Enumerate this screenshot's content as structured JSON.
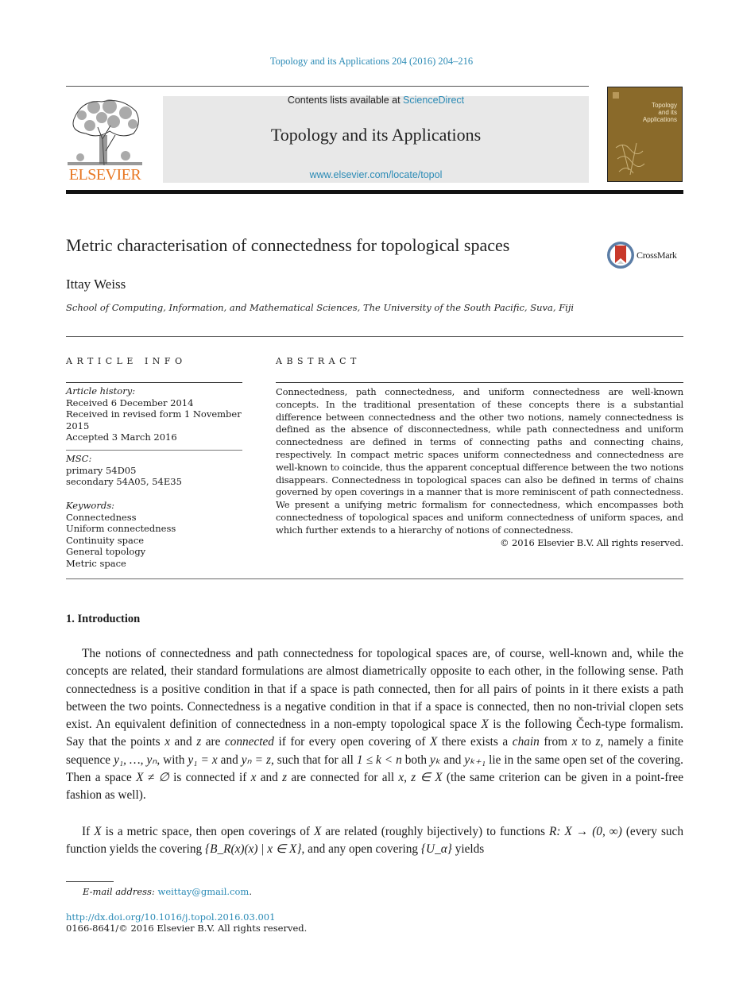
{
  "header": {
    "journal_reference": "Topology and its Applications 204 (2016) 204–216",
    "contents_prefix": "Contents lists available at ",
    "contents_link": "ScienceDirect",
    "journal_title": "Topology and its Applications",
    "journal_url": "www.elsevier.com/locate/topol",
    "publisher_logo_text": "ELSEVIER",
    "cover_title": "Topology\nand its\nApplications",
    "colors": {
      "link": "#2a8ab5",
      "publisher_orange": "#e87722",
      "cover_brown": "#8a6a2a"
    }
  },
  "article": {
    "title": "Metric characterisation of connectedness for topological spaces",
    "crossmark_label": "CrossMark",
    "author": "Ittay Weiss",
    "affiliation": "School of Computing, Information, and Mathematical Sciences, The University of the South Pacific, Suva, Fiji"
  },
  "article_info": {
    "heading": "ARTICLE INFO",
    "history_label": "Article history:",
    "history": [
      "Received 6 December 2014",
      "Received in revised form 1 November 2015",
      "Accepted 3 March 2016"
    ],
    "msc_label": "MSC:",
    "msc": [
      "primary 54D05",
      "secondary 54A05, 54E35"
    ],
    "keywords_label": "Keywords:",
    "keywords": [
      "Connectedness",
      "Uniform connectedness",
      "Continuity space",
      "General topology",
      "Metric space"
    ]
  },
  "abstract": {
    "heading": "ABSTRACT",
    "text": "Connectedness, path connectedness, and uniform connectedness are well-known concepts. In the traditional presentation of these concepts there is a substantial difference between connectedness and the other two notions, namely connectedness is defined as the absence of disconnectedness, while path connectedness and uniform connectedness are defined in terms of connecting paths and connecting chains, respectively. In compact metric spaces uniform connectedness and connectedness are well-known to coincide, thus the apparent conceptual difference between the two notions disappears. Connectedness in topological spaces can also be defined in terms of chains governed by open coverings in a manner that is more reminiscent of path connectedness. We present a unifying metric formalism for connectedness, which encompasses both connectedness of topological spaces and uniform connectedness of uniform spaces, and which further extends to a hierarchy of notions of connectedness.",
    "copyright": "© 2016 Elsevier B.V. All rights reserved."
  },
  "introduction": {
    "heading": "1.  Introduction",
    "p1": {
      "a": "The notions of connectedness and path connectedness for topological spaces are, of course, well-known and, while the concepts are related, their standard formulations are almost diametrically opposite to each other, in the following sense. Path connectedness is a positive condition in that if a space is path connected, then for all pairs of points in it there exists a path between the two points. Connectedness is a negative condition in that if a space is connected, then no non-trivial clopen sets exist. An equivalent definition of connectedness in a non-empty topological space ",
      "X1": "X",
      "b": " is the following Čech-type formalism. Say that the points ",
      "x1": "x",
      "c": " and ",
      "z1": "z",
      "d": " are ",
      "connected": "connected",
      "e": " if for every open covering of ",
      "X2": "X",
      "f": " there exists a ",
      "chain": "chain",
      "g": " from ",
      "x2": "x",
      "h": " to ",
      "z2": "z",
      "i": ", namely a finite sequence ",
      "seq": "y₁, …, yₙ",
      "j": ", with ",
      "eq1": "y₁ = x",
      "k": " and ",
      "eq2": "yₙ = z",
      "l": ", such that for all ",
      "ineq": "1 ≤ k < n",
      "m": " both ",
      "yk": "yₖ",
      "n": " and ",
      "yk1": "yₖ₊₁",
      "o": " lie in the same open set of the covering. Then a space ",
      "neq": "X ≠ ∅",
      "p": " is connected if ",
      "x3": "x",
      "q": " and ",
      "z3": "z",
      "r": " are connected for all ",
      "xz": "x, z ∈ X",
      "s": " (the same criterion can be given in a point-free fashion as well)."
    },
    "p2": {
      "a": "If ",
      "X1": "X",
      "b": " is a metric space, then open coverings of ",
      "X2": "X",
      "c": " are related (roughly bijectively) to functions ",
      "fn": "R: X → (0, ∞)",
      "d": " (every such function yields the covering ",
      "cov": "{B_R(x)(x) | x ∈ X}",
      "e": ", and any open covering ",
      "ua": "{U_α}",
      "f": " yields"
    }
  },
  "footnotes": {
    "email_label": "E-mail address:",
    "email": "weittay@gmail.com",
    "doi": "http://dx.doi.org/10.1016/j.topol.2016.03.001",
    "issn_line": "0166-8641/© 2016 Elsevier B.V. All rights reserved."
  }
}
